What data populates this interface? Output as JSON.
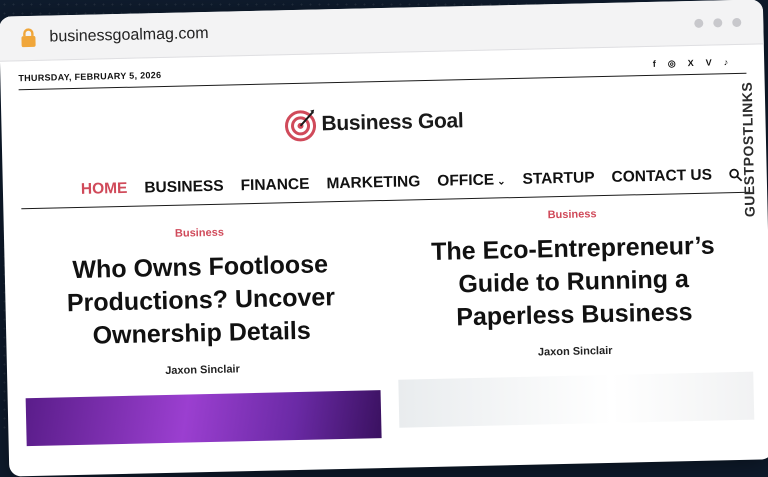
{
  "browser": {
    "url": "businessgoalmag.com"
  },
  "topbar": {
    "date": "THURSDAY, FEBRUARY 5, 2026",
    "social": [
      "f",
      "◎",
      "X",
      "V",
      "♪"
    ]
  },
  "site": {
    "name": "Business Goal"
  },
  "nav": {
    "items": [
      "HOME",
      "BUSINESS",
      "FINANCE",
      "MARKETING",
      "OFFICE",
      "STARTUP",
      "CONTACT US"
    ]
  },
  "articles": [
    {
      "category": "Business",
      "title": "Who Owns Footloose Productions? Uncover Ownership Details",
      "author": "Jaxon Sinclair"
    },
    {
      "category": "Business",
      "title": "The Eco-Entrepreneur’s Guide to Running a Paperless Business",
      "author": "Jaxon Sinclair"
    }
  ],
  "watermark": {
    "text": "GUESTPOSTLINKS"
  },
  "colors": {
    "accent": "#d04a5a",
    "background": "#0f1c2e",
    "lock": "#f0a63a"
  }
}
